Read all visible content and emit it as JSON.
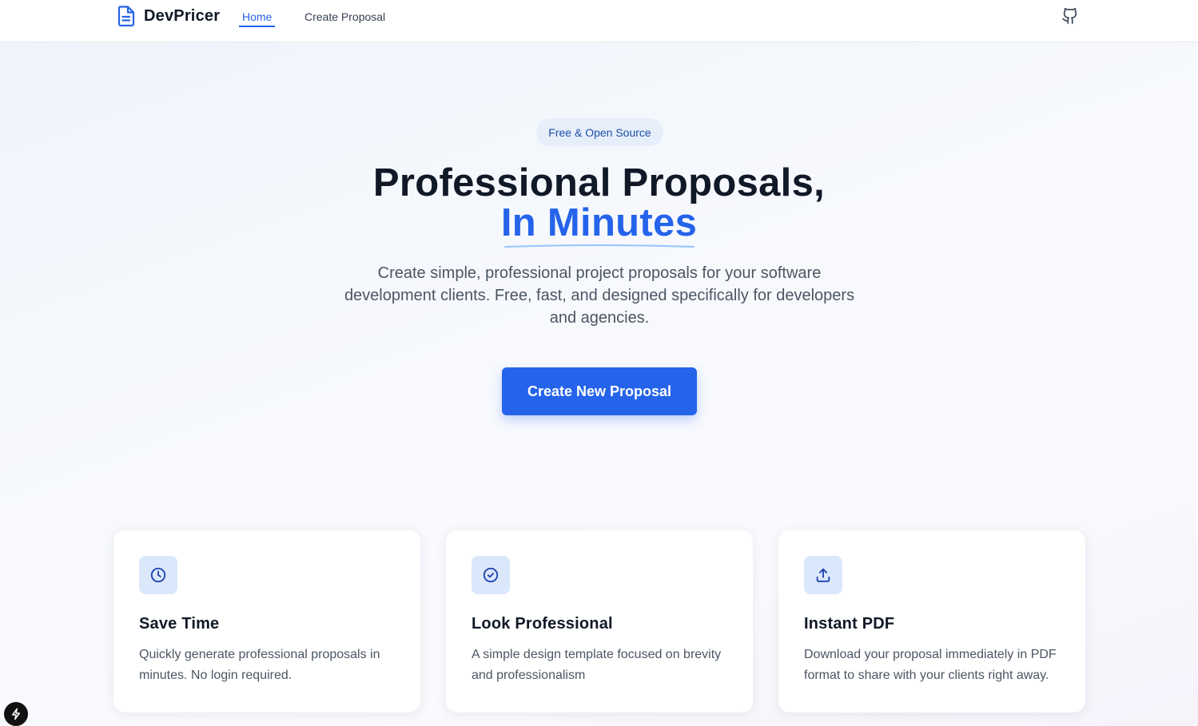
{
  "nav": {
    "brand_name": "DevPricer",
    "links": [
      {
        "label": "Home",
        "active": true
      },
      {
        "label": "Create Proposal",
        "active": false
      }
    ],
    "github_icon": "github-icon"
  },
  "hero": {
    "badge": "Free & Open Source",
    "title_line1": "Professional Proposals,",
    "title_line2": "In Minutes",
    "description": "Create simple, professional project proposals for your software development clients. Free, fast, and designed specifically for developers and agencies.",
    "cta_label": "Create New Proposal"
  },
  "features": [
    {
      "icon": "clock-icon",
      "title": "Save Time",
      "description": "Quickly generate professional proposals in minutes. No login required."
    },
    {
      "icon": "check-circle-icon",
      "title": "Look Professional",
      "description": "A simple design template focused on brevity and professionalism"
    },
    {
      "icon": "upload-icon",
      "title": "Instant PDF",
      "description": "Download your proposal immediately in PDF format to share with your clients right away."
    }
  ],
  "colors": {
    "accent": "#2563eb",
    "badge_bg": "#e6eefa",
    "icon_bg": "#dbe7fb",
    "heading": "#111827",
    "body_text": "#4b5563"
  }
}
